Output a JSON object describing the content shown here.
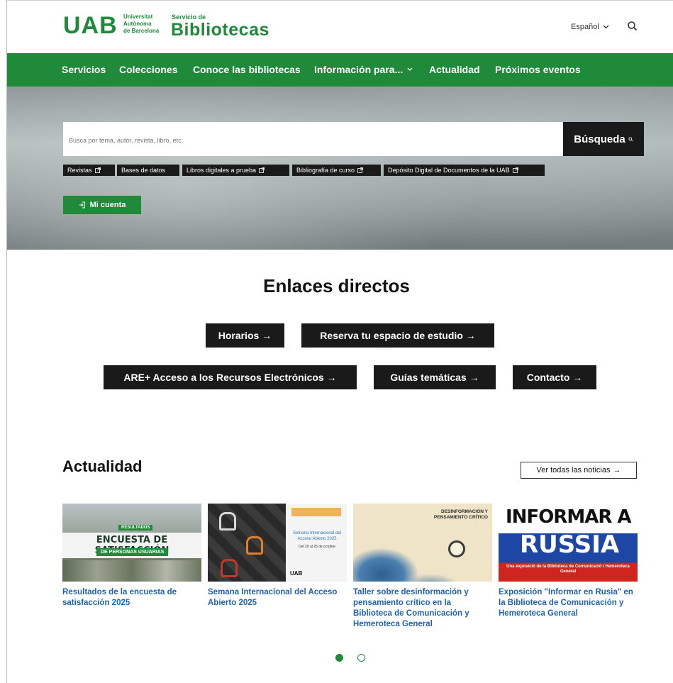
{
  "header": {
    "logo": "UAB",
    "university_lines": [
      "Universitat",
      "Autònoma",
      "de Barcelona"
    ],
    "service_label": "Servicio de",
    "service_name": "Bibliotecas",
    "language": "Español"
  },
  "nav": {
    "items": [
      "Servicios",
      "Colecciones",
      "Conoce las bibliotecas",
      "Información para...",
      "Actualidad",
      "Próximos eventos"
    ]
  },
  "search": {
    "placeholder": "Busca por tema, autor, revista, libro, etc.",
    "button_label": "Búsqueda"
  },
  "quick_links": [
    "Revistas",
    "Bases de datos",
    "Libros digitales a prueba",
    "Bibliografía de curso",
    "Depósito Digital de Documentos de la UAB"
  ],
  "account_button": "Mi cuenta",
  "direct_links": {
    "title": "Enlaces directos",
    "items": [
      "Horarios →",
      "Reserva tu espacio de estudio →",
      "ARE+ Acceso a los Recursos Electrónicos →",
      "Guías temáticas →",
      "Contacto →"
    ]
  },
  "news": {
    "title": "Actualidad",
    "view_all": "Ver todas las noticias",
    "items": [
      {
        "title": "Resultados de la encuesta de satisfacción 2025",
        "image_text": [
          "RESULTADOS",
          "ENCUESTA DE SATISFACCIÓN",
          "DE PERSONAS USUARIAS"
        ]
      },
      {
        "title": "Semana Internacional del Acceso Abierto 2025",
        "image_text": [
          "Semana Internacional del Acceso Abierto 2025",
          "Del 20 al 26 de octubre",
          "UAB"
        ]
      },
      {
        "title": "Taller sobre desinformación y pensamiento crítico en la Biblioteca de Comunicación y Hemeroteca General",
        "image_text": [
          "DESINFORMACIÓN Y PENSAMIENTO CRÍTICO"
        ]
      },
      {
        "title": "Exposición \"Informar en Rusia\" en la Biblioteca de Comunicación y Hemeroteca General",
        "image_text": [
          "INFORMAR A",
          "RÚSSIA",
          "Una exposició de la Biblioteca de Comunicació i Hemeroteca General"
        ]
      }
    ]
  },
  "colors": {
    "brand_green": "#1e8a3a",
    "dark": "#1a1a1a",
    "link_blue": "#1f63b0"
  }
}
